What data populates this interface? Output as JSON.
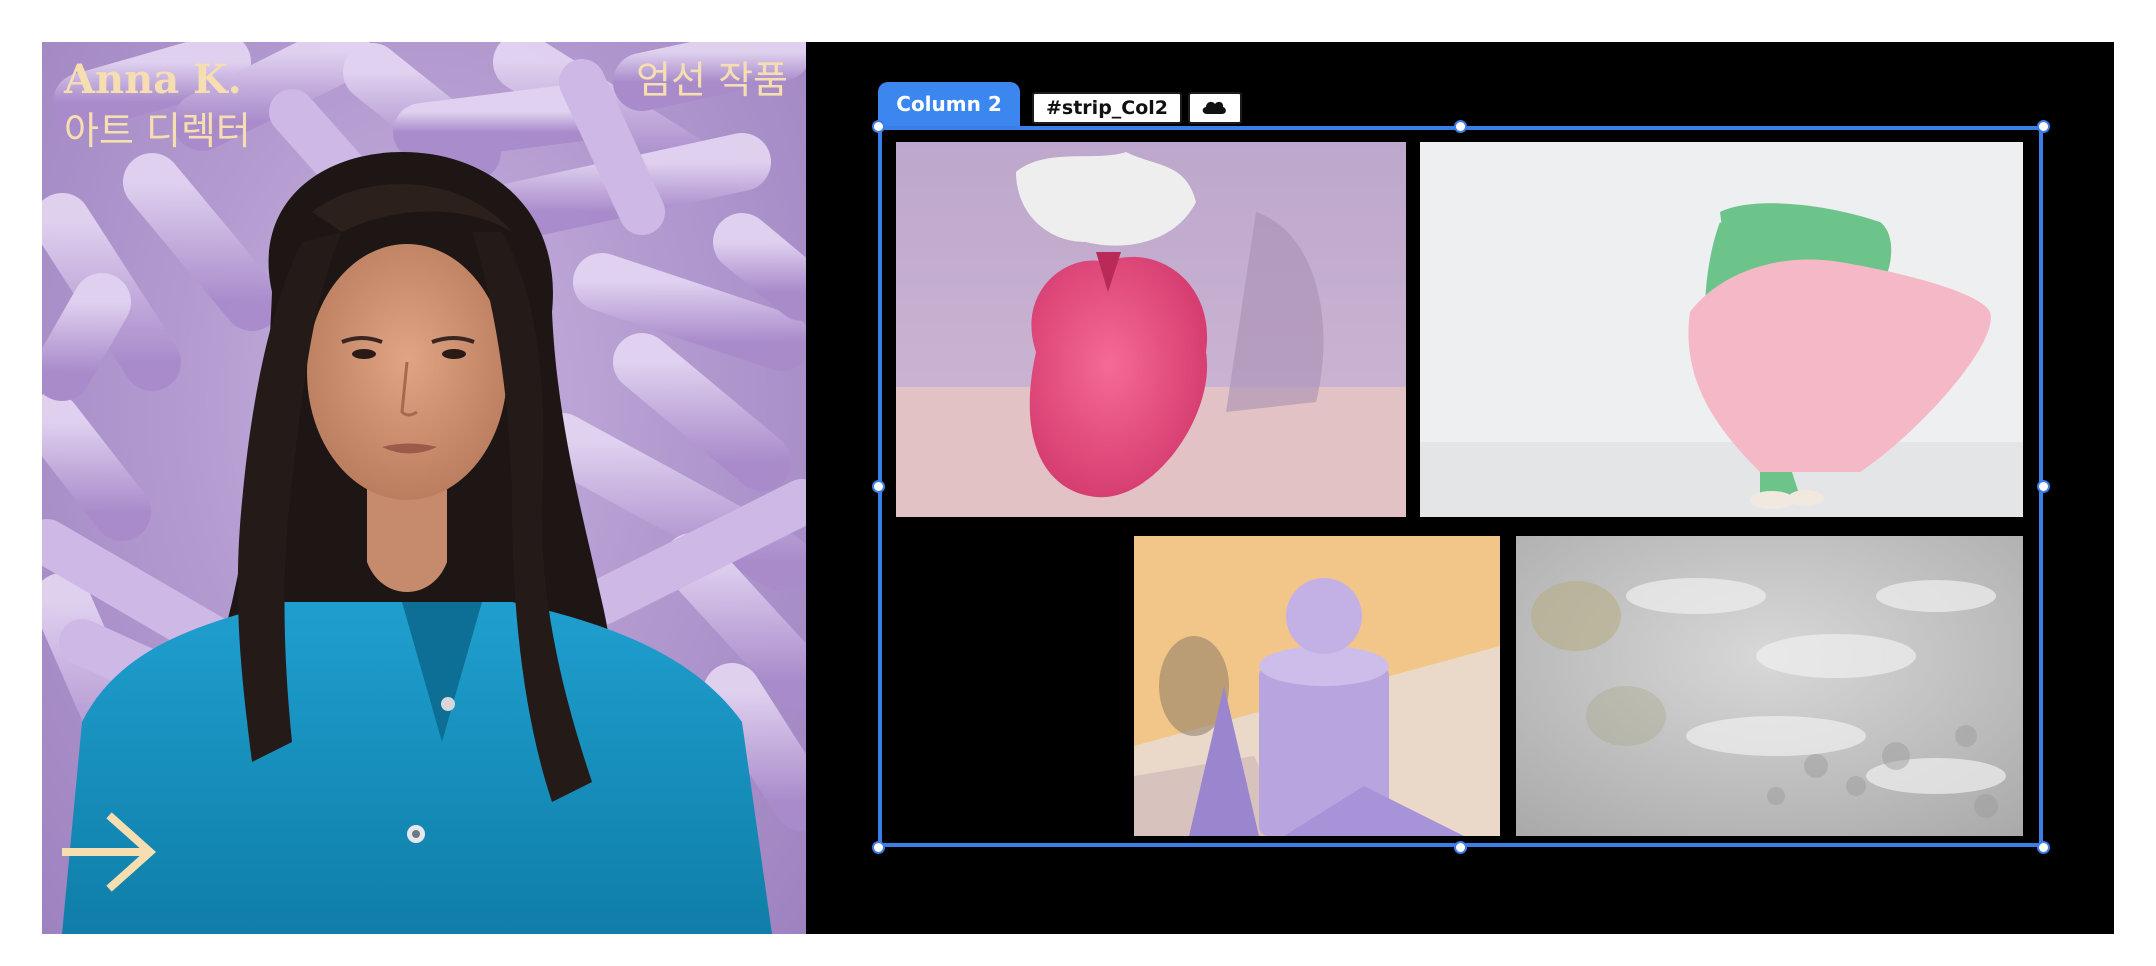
{
  "portrait": {
    "name": "Anna K.",
    "role": "아트 디렉터",
    "selected_works": "엄선 작품",
    "arrow_icon": "arrow-right-icon",
    "text_color": "#f6deb0"
  },
  "editor": {
    "tab_label": "Column 2",
    "id_chip": "#strip_Col2",
    "cloud_icon": "cloud-icon",
    "accent_color": "#3c7ee8"
  }
}
